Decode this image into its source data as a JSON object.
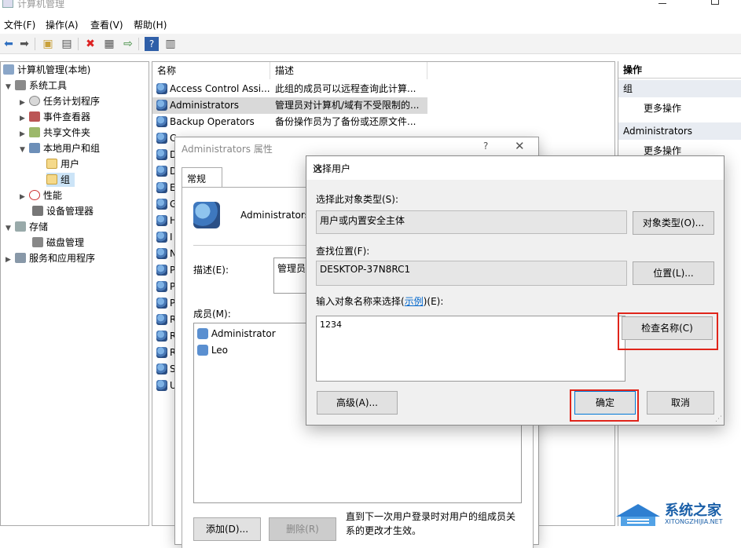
{
  "window": {
    "title": "计算机管理"
  },
  "menu": [
    "文件(F)",
    "操作(A)",
    "查看(V)",
    "帮助(H)"
  ],
  "tree": {
    "root": "计算机管理(本地)",
    "system_tools": "系统工具",
    "task_scheduler": "任务计划程序",
    "event_viewer": "事件查看器",
    "shared_folders": "共享文件夹",
    "local_users_groups": "本地用户和组",
    "users": "用户",
    "groups": "组",
    "performance": "性能",
    "device_manager": "设备管理器",
    "storage": "存储",
    "disk_management": "磁盘管理",
    "services_apps": "服务和应用程序"
  },
  "list": {
    "col_name": "名称",
    "col_desc": "描述",
    "rows": [
      {
        "name": "Access Control Assi...",
        "desc": "此组的成员可以远程查询此计算..."
      },
      {
        "name": "Administrators",
        "desc": "管理员对计算机/域有不受限制的..."
      },
      {
        "name": "Backup Operators",
        "desc": "备份操作员为了备份或还原文件..."
      },
      {
        "name": "C",
        "desc": ""
      },
      {
        "name": "D",
        "desc": ""
      },
      {
        "name": "D",
        "desc": ""
      },
      {
        "name": "E",
        "desc": ""
      },
      {
        "name": "G",
        "desc": ""
      },
      {
        "name": "H",
        "desc": ""
      },
      {
        "name": "I",
        "desc": ""
      },
      {
        "name": "N",
        "desc": ""
      },
      {
        "name": "P",
        "desc": ""
      },
      {
        "name": "P",
        "desc": ""
      },
      {
        "name": "P",
        "desc": ""
      },
      {
        "name": "R",
        "desc": ""
      },
      {
        "name": "R",
        "desc": ""
      },
      {
        "name": "R",
        "desc": ""
      },
      {
        "name": "S",
        "desc": ""
      },
      {
        "name": "U",
        "desc": ""
      }
    ]
  },
  "actions": {
    "header": "操作",
    "section1": "组",
    "more1": "更多操作",
    "section2": "Administrators",
    "more2": "更多操作"
  },
  "props": {
    "title": "Administrators 属性",
    "help": "?",
    "tab": "常规",
    "group_name": "Administrators",
    "desc_label": "描述(E):",
    "desc_value": "管理员",
    "members_label": "成员(M):",
    "members": [
      "Administrator",
      "Leo"
    ],
    "note": "直到下一次用户登录时对用户的组成员关系的更改才生效。",
    "add": "添加(D)...",
    "remove": "删除(R)"
  },
  "select": {
    "title": "选择用户",
    "type_label": "选择此对象类型(S):",
    "type_value": "用户或内置安全主体",
    "type_btn": "对象类型(O)...",
    "loc_label": "查找位置(F):",
    "loc_value": "DESKTOP-37N8RC1",
    "loc_btn": "位置(L)...",
    "name_label_pre": "输入对象名称来选择(",
    "name_label_link": "示例",
    "name_label_post": ")(E):",
    "name_value": "1234",
    "check_btn": "检查名称(C)",
    "advanced_btn": "高级(A)...",
    "ok_btn": "确定",
    "cancel_btn": "取消"
  },
  "watermark": {
    "text": "系统之家",
    "sub": "XITONGZHIJIA.NET"
  }
}
